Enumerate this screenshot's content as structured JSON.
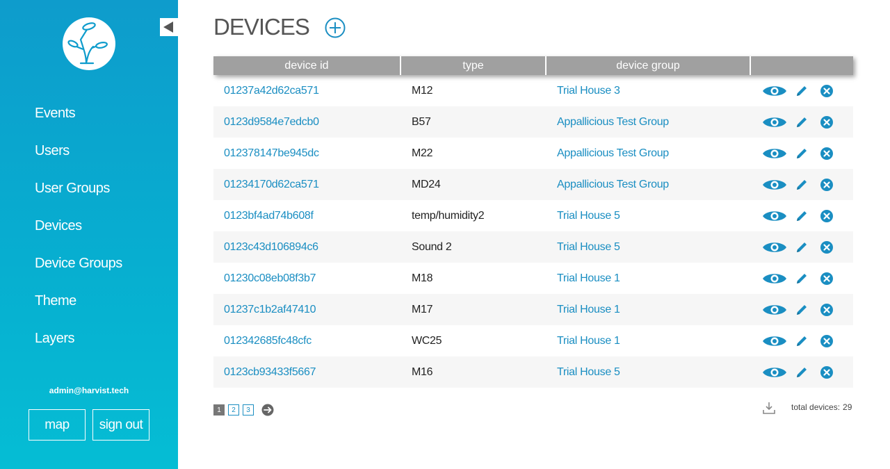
{
  "sidebar": {
    "items": [
      {
        "label": "Events"
      },
      {
        "label": "Users"
      },
      {
        "label": "User Groups"
      },
      {
        "label": "Devices"
      },
      {
        "label": "Device Groups"
      },
      {
        "label": "Theme"
      },
      {
        "label": "Layers"
      }
    ],
    "user_email": "admin@harvist.tech",
    "map_label": "map",
    "signout_label": "sign out"
  },
  "page": {
    "title": "DEVICES"
  },
  "table": {
    "headers": [
      "device id",
      "type",
      "device group",
      ""
    ],
    "rows": [
      {
        "device_id": "01237a42d62ca571",
        "type": "M12",
        "group": "Trial House 3"
      },
      {
        "device_id": "0123d9584e7edcb0",
        "type": "B57",
        "group": "Appallicious Test Group"
      },
      {
        "device_id": "012378147be945dc",
        "type": "M22",
        "group": "Appallicious Test Group"
      },
      {
        "device_id": "01234170d62ca571",
        "type": "MD24",
        "group": "Appallicious Test Group"
      },
      {
        "device_id": "0123bf4ad74b608f",
        "type": "temp/humidity2",
        "group": "Trial House 5"
      },
      {
        "device_id": "0123c43d106894c6",
        "type": "Sound 2",
        "group": "Trial House 5"
      },
      {
        "device_id": "01230c08eb08f3b7",
        "type": "M18",
        "group": "Trial House 1"
      },
      {
        "device_id": "01237c1b2af47410",
        "type": "M17",
        "group": "Trial House 1"
      },
      {
        "device_id": "012342685fc48cfc",
        "type": "WC25",
        "group": "Trial House 1"
      },
      {
        "device_id": "0123cb93433f5667",
        "type": "M16",
        "group": "Trial House 5"
      }
    ]
  },
  "pagination": {
    "pages": [
      "1",
      "2",
      "3"
    ],
    "current": "1"
  },
  "footer": {
    "total_label": "total devices:",
    "total_count": "29"
  },
  "colors": {
    "sidebar_top": "#0e9ccc",
    "sidebar_bottom": "#05bdd4",
    "link": "#1a8ec2",
    "header_bg": "#a0a0a0"
  }
}
